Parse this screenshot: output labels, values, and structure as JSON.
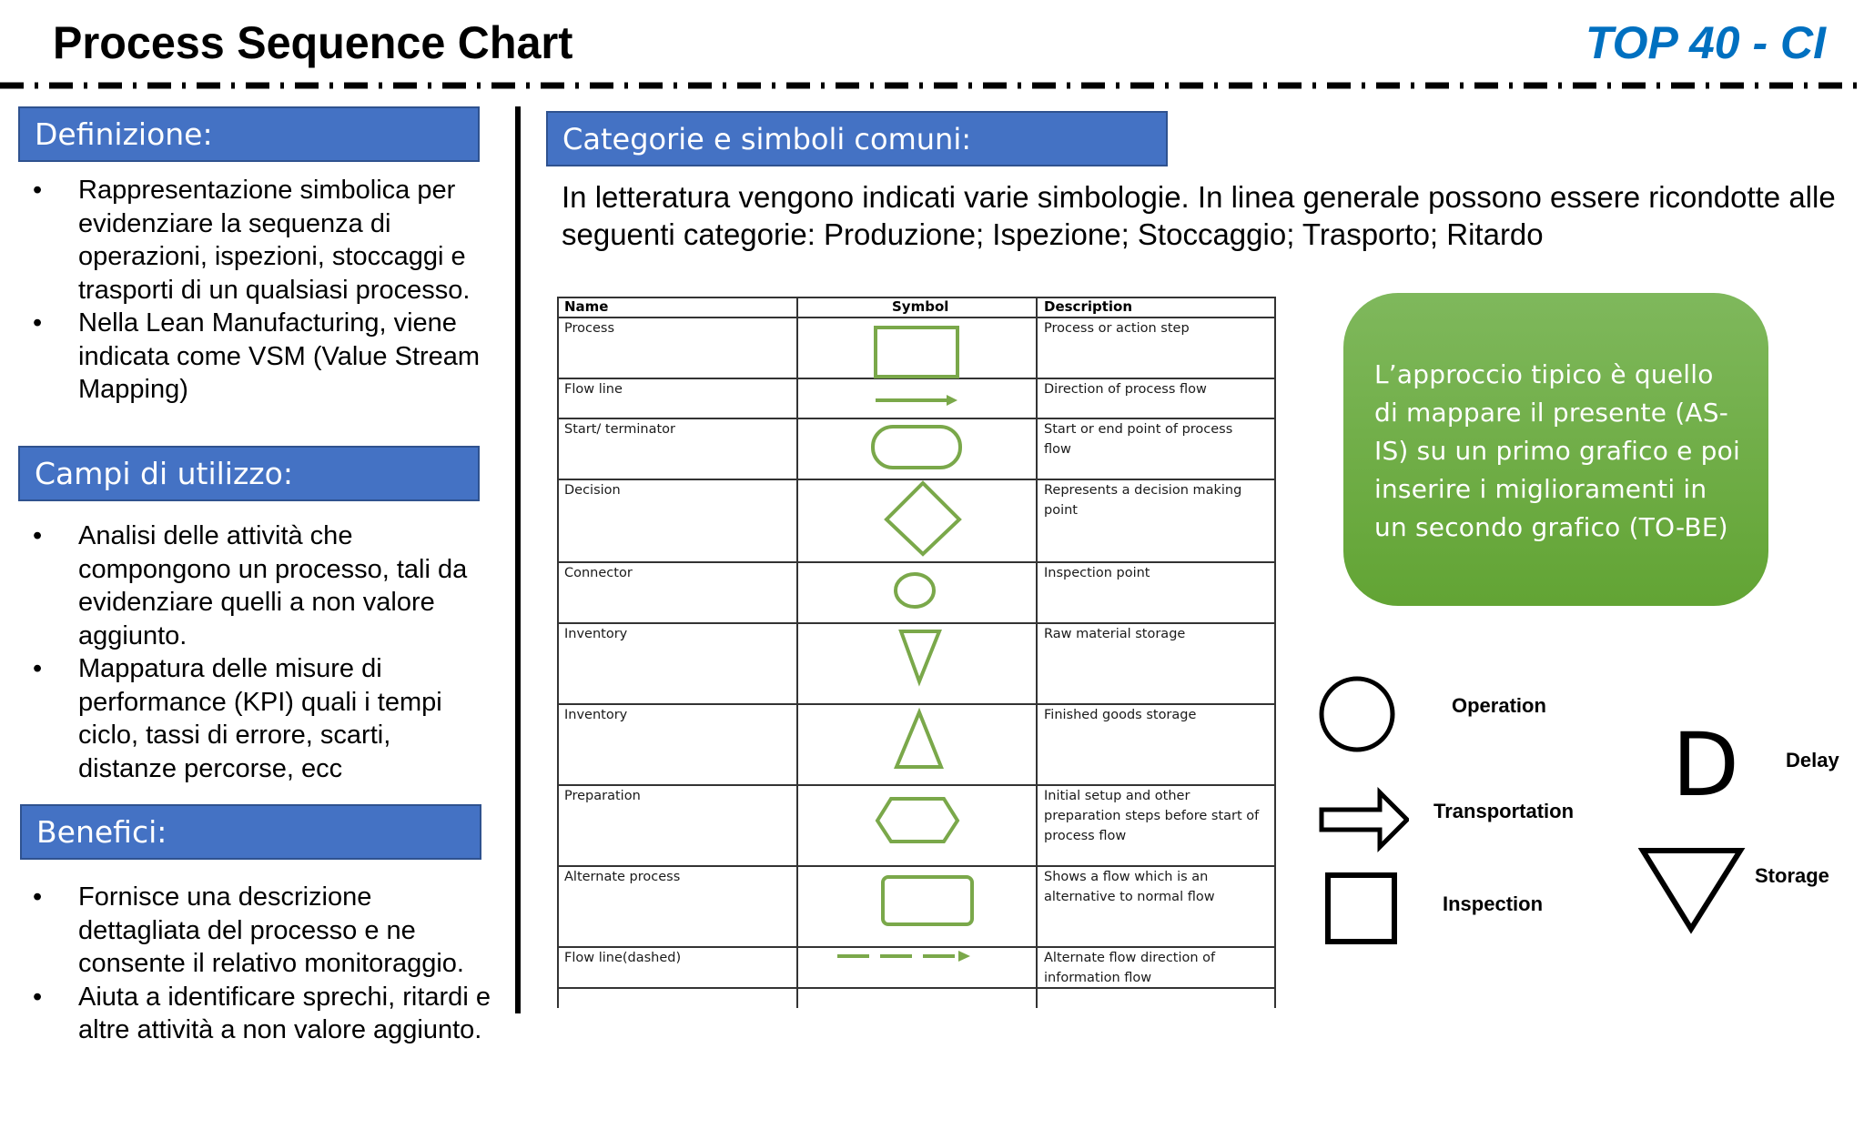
{
  "header": {
    "title": "Process Sequence Chart",
    "brand": "TOP 40 - CI"
  },
  "sections": {
    "definizione": {
      "title": "Definizione:",
      "bullets": [
        "Rappresentazione simbolica per evidenziare la sequenza di operazioni, ispezioni, stoccaggi e trasporti di un qualsiasi processo.",
        "Nella Lean Manufacturing, viene indicata come VSM (Value Stream Mapping)"
      ]
    },
    "campi": {
      "title": "Campi di utilizzo:",
      "bullets": [
        "Analisi delle attività che compongono un processo, tali da evidenziare quelli a non valore aggiunto.",
        "Mappatura delle misure di performance (KPI) quali i tempi ciclo, tassi di errore, scarti, distanze percorse, ecc"
      ]
    },
    "benefici": {
      "title": "Benefici:",
      "bullets": [
        "Fornisce una descrizione dettagliata del processo e ne consente il relativo monitoraggio.",
        "Aiuta a identificare sprechi, ritardi e altre attività a non valore aggiunto."
      ]
    },
    "categorie": {
      "title": "Categorie e simboli comuni:",
      "intro": "In letteratura vengono indicati varie simbologie. In linea generale possono essere ricondotte alle seguenti categorie: Produzione; Ispezione; Stoccaggio; Trasporto; Ritardo"
    }
  },
  "symbol_table": {
    "headers": [
      "Name",
      "Symbol",
      "Description"
    ],
    "symbol_color": "#7aa84a",
    "rows": [
      {
        "name": "Process",
        "symbol": "rectangle-icon",
        "description": [
          "Process or action step"
        ]
      },
      {
        "name": "Flow line",
        "symbol": "arrow-right-icon",
        "description": [
          "Direction of process flow"
        ]
      },
      {
        "name": "Start/ terminator",
        "symbol": "terminator-icon",
        "description": [
          "Start or end point of process",
          "flow"
        ]
      },
      {
        "name": "Decision",
        "symbol": "diamond-icon",
        "description": [
          "Represents a decision making",
          "point"
        ]
      },
      {
        "name": "Connector",
        "symbol": "circle-icon",
        "description": [
          "Inspection point"
        ]
      },
      {
        "name": "Inventory",
        "symbol": "triangle-down-icon",
        "description": [
          "Raw material storage"
        ]
      },
      {
        "name": "Inventory",
        "symbol": "triangle-up-icon",
        "description": [
          "Finished goods storage"
        ]
      },
      {
        "name": "Preparation",
        "symbol": "hexagon-icon",
        "description": [
          "Initial setup and other",
          "preparation steps before start of",
          "process flow"
        ]
      },
      {
        "name": "Alternate process",
        "symbol": "rounded-rectangle-icon",
        "description": [
          "Shows a flow which is an",
          "alternative to normal flow"
        ]
      },
      {
        "name": "Flow line(dashed)",
        "symbol": "dashed-arrow-icon",
        "description": [
          "Alternate flow direction of",
          "information flow"
        ]
      },
      {
        "name": "",
        "symbol": "",
        "description": [
          ""
        ]
      }
    ]
  },
  "callout": {
    "text": "L’approccio tipico è quello di mappare il presente (AS-IS) su un primo grafico e poi inserire i miglioramenti in un secondo grafico (TO-BE)",
    "color": "#70ad47"
  },
  "legend": {
    "items": [
      {
        "label": "Operation",
        "symbol": "circle-icon"
      },
      {
        "label": "Transportation",
        "symbol": "block-arrow-icon"
      },
      {
        "label": "Inspection",
        "symbol": "square-icon"
      },
      {
        "label": "Delay",
        "symbol": "letter-d-icon",
        "glyph": "D"
      },
      {
        "label": "Storage",
        "symbol": "triangle-down-icon"
      }
    ]
  },
  "colors": {
    "section_bar": "#4472c4",
    "brand": "#0070c0",
    "callout_green": "#70ad47"
  }
}
